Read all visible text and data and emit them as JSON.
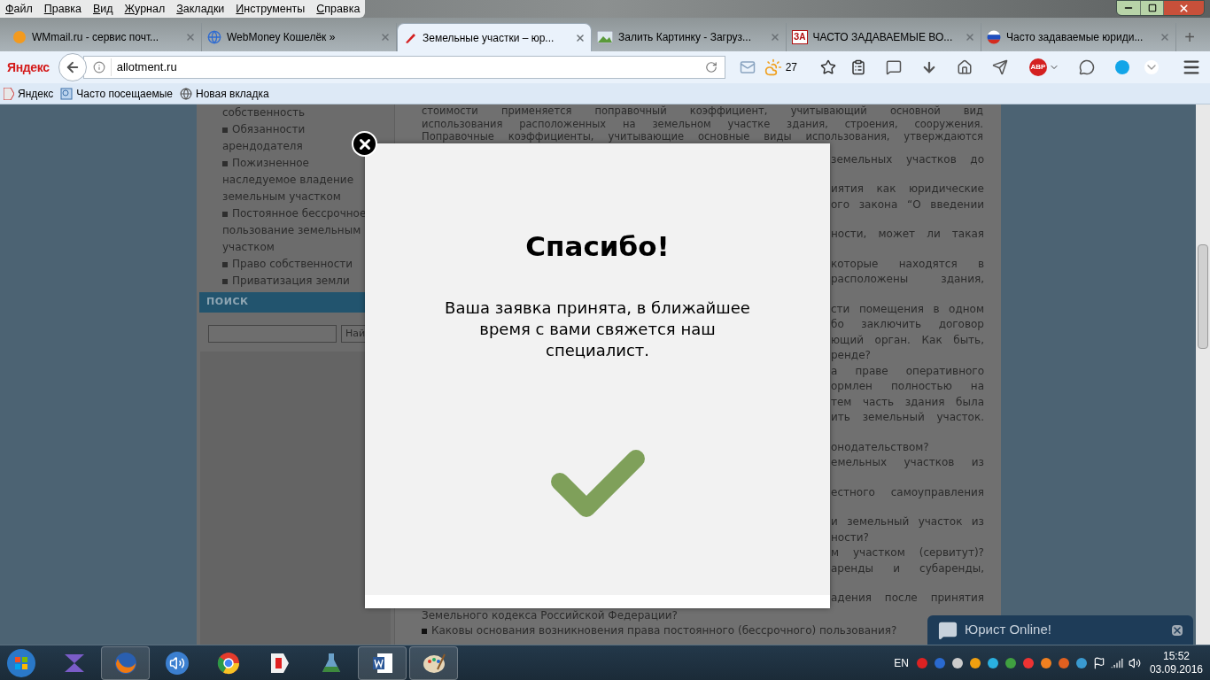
{
  "menu": [
    {
      "label": "Файл"
    },
    {
      "label": "Правка"
    },
    {
      "label": "Вид"
    },
    {
      "label": "Журнал"
    },
    {
      "label": "Закладки"
    },
    {
      "label": "Инструменты"
    },
    {
      "label": "Справка"
    }
  ],
  "tabs": [
    {
      "title": "WMmail.ru - сервис почт...",
      "selected": false
    },
    {
      "title": "WebMoney Кошелёк »",
      "selected": false
    },
    {
      "title": "Земельные участки – юр...",
      "selected": true
    },
    {
      "title": "Залить Картинку - Загруз...",
      "selected": false
    },
    {
      "title": "ЧАСТО ЗАДАВАЕМЫЕ ВО...",
      "selected": false,
      "badge": "ЗА"
    },
    {
      "title": "Часто задаваемые юриди...",
      "selected": false
    }
  ],
  "new_tab": "+",
  "navbar": {
    "brand": "Яндекс",
    "url": "allotment.ru",
    "weather_temp": "27",
    "adblock": "ABP"
  },
  "bookmarks": [
    {
      "label": "Яндекс"
    },
    {
      "label": "Часто посещаемые"
    },
    {
      "label": "Новая вкладка"
    }
  ],
  "sidebar": {
    "items": [
      {
        "text": "собственность",
        "bullet": false
      },
      {
        "text": "Обязанности арендодателя",
        "bullet": true
      },
      {
        "text": "Пожизненное наследуемое владение земельным участком",
        "bullet": true
      },
      {
        "text": "Постоянное бессрочное пользование земельным участком",
        "bullet": true
      },
      {
        "text": "Право собственности",
        "bullet": true
      },
      {
        "text": "Приватизация земли",
        "bullet": true
      }
    ],
    "search_title": "ПОИСК",
    "search_button": "Най"
  },
  "article": {
    "top_lines": [
      "стоимости применяется поправочный коэффициент, учитывающий основной вид",
      "использования расположенных на земельном участке здания, строения, сооружения.",
      "Поправочные коэффициенты, учитывающие основные виды использования, утверждаются"
    ],
    "fragments": [
      [
        "земельных участков до"
      ],
      [
        "иятия как юридические",
        "ого закона “О введении"
      ],
      [
        "ности, может ли такая"
      ],
      [
        "которые находятся в",
        "расположены здания,"
      ],
      [
        "сти помещения в одном",
        "бо заключить договор",
        "ющий орган. Как быть,",
        "ренде?",
        "а праве оперативного",
        "ормлен полностью на",
        "тем часть здания была",
        "ить земельный участок."
      ],
      [
        "онодательством?",
        "емельных участков из"
      ],
      [
        "естного самоуправления"
      ],
      [
        "и земельный участок из",
        "ности?",
        "м участком (сервитут)?",
        "аренды и субаренды,"
      ],
      [
        "адения после принятия"
      ]
    ],
    "bottom_lines": [
      {
        "text": "Земельного кодекса Российской Федерации?",
        "bullet": false
      },
      {
        "text": "Каковы основания возникновения права постоянного (бессрочного) пользования?",
        "bullet": true
      }
    ]
  },
  "modal": {
    "title": "Спасибо!",
    "message": "Ваша заявка принята, в ближайшее время с вами свяжется наш специалист."
  },
  "chat_widget": {
    "label": "Юрист Online!"
  },
  "taskbar": {
    "language": "EN",
    "time": "15:52",
    "date": "03.09.2016"
  }
}
